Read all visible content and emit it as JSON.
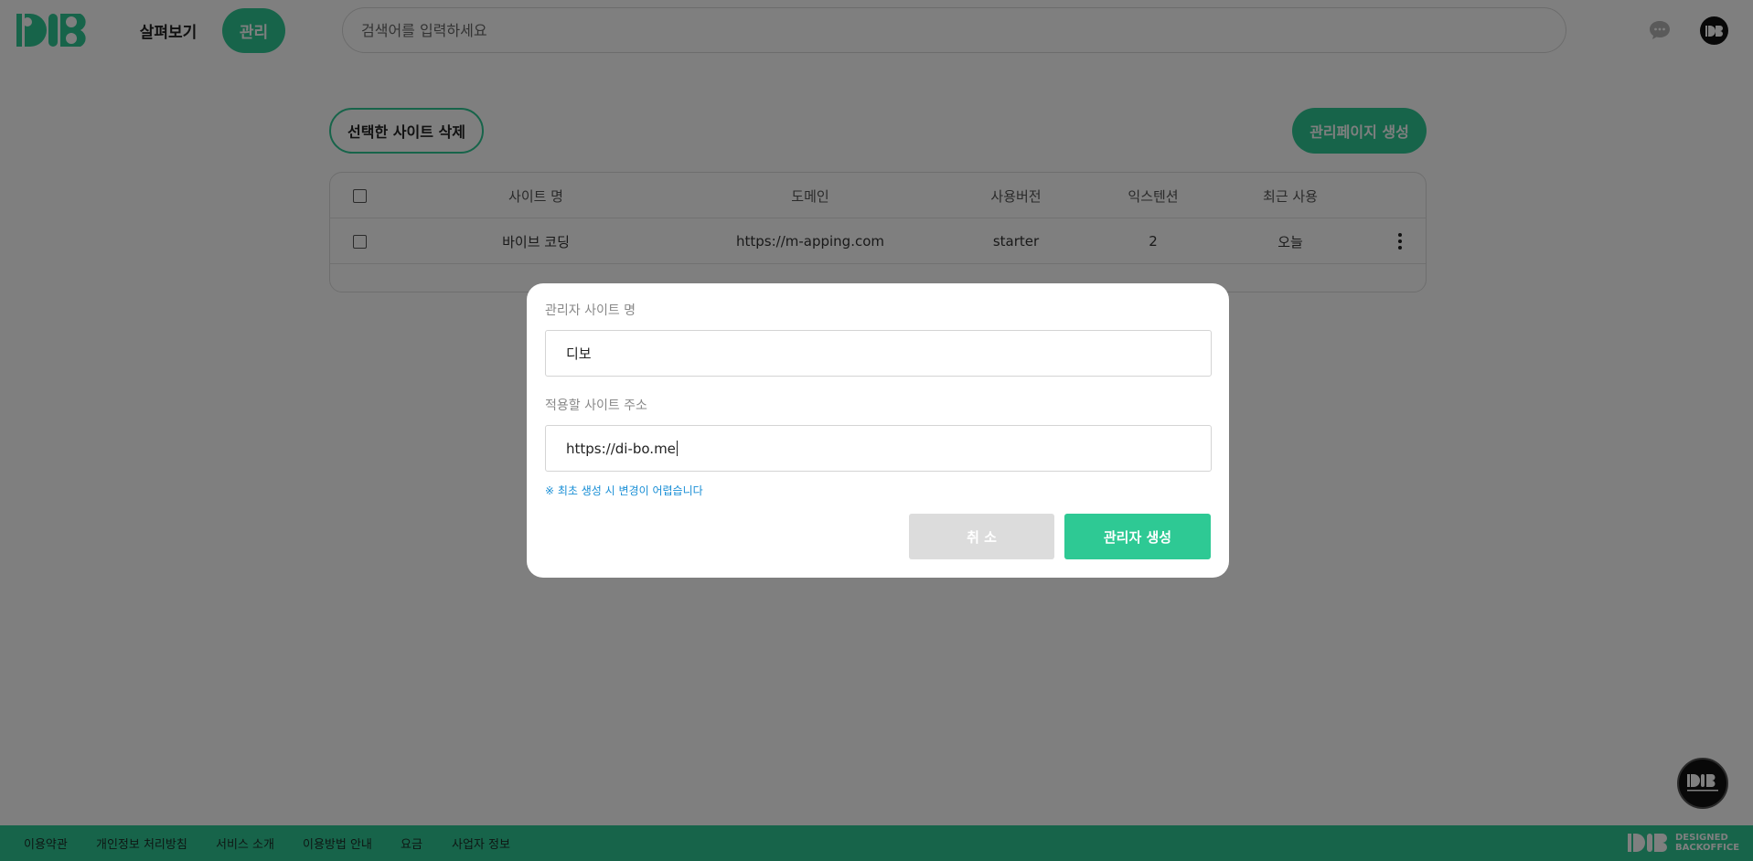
{
  "header": {
    "nav_browse": "살펴보기",
    "nav_manage": "관리",
    "search_placeholder": "검색어를 입력하세요"
  },
  "toolbar": {
    "delete_selected": "선택한 사이트 삭제",
    "create_admin_page": "관리페이지 생성"
  },
  "table": {
    "columns": [
      "사이트 명",
      "도메인",
      "사용버전",
      "익스텐션",
      "최근 사용"
    ],
    "rows": [
      {
        "name": "바이브 코딩",
        "domain": "https://m-apping.com",
        "version": "starter",
        "extensions": "2",
        "last_used": "오늘"
      }
    ]
  },
  "modal": {
    "site_name_label": "관리자 사이트 명",
    "site_name_value": "디보",
    "site_url_label": "적용할 사이트 주소",
    "site_url_value": "https://di-bo.me",
    "notice": "※ 최초 생성 시 변경이 어렵습니다",
    "cancel": "취 소",
    "create": "관리자 생성"
  },
  "footer": {
    "links": [
      "이용약관",
      "개인정보 처리방침",
      "서비스 소개",
      "이용방법 안내",
      "요금",
      "사업자 정보"
    ],
    "brand_line1": "DESIGNED",
    "brand_line2": "BACKOFFICE"
  },
  "colors": {
    "accent": "#2ec994",
    "notice": "#1a8fd6",
    "overlay": "rgba(0,0,0,0.5)"
  }
}
